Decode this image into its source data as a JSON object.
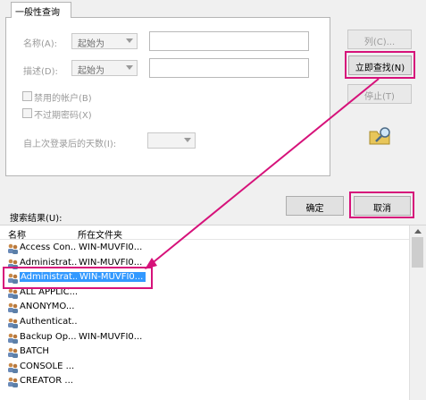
{
  "tab": {
    "label": "一般性查询"
  },
  "form": {
    "name_label": "名称(A):",
    "name_mode": "起始为",
    "desc_label": "描述(D):",
    "desc_mode": "起始为",
    "disabled_accounts_label": "禁用的帐户(B)",
    "no_expire_password_label": "不过期密码(X)",
    "days_since_logon_label": "自上次登录后的天数(I):"
  },
  "buttons": {
    "columns": "列(C)...",
    "find_now": "立即查找(N)",
    "stop": "停止(T)",
    "ok": "确定",
    "cancel": "取消"
  },
  "results": {
    "label": "搜索结果(U):",
    "columns": [
      "名称",
      "所在文件夹"
    ],
    "rows": [
      {
        "name": "Access Con...",
        "folder": "WIN-MUVFI0..."
      },
      {
        "name": "Administrat...",
        "folder": "WIN-MUVFI0..."
      },
      {
        "name": "Administrat...",
        "folder": "WIN-MUVFI0...",
        "selected": true
      },
      {
        "name": "ALL APPLIC...",
        "folder": ""
      },
      {
        "name": "ANONYMO...",
        "folder": ""
      },
      {
        "name": "Authenticat...",
        "folder": ""
      },
      {
        "name": "Backup Op...",
        "folder": "WIN-MUVFI0..."
      },
      {
        "name": "BATCH",
        "folder": ""
      },
      {
        "name": "CONSOLE ...",
        "folder": ""
      },
      {
        "name": "CREATOR ...",
        "folder": ""
      }
    ]
  },
  "colors": {
    "highlight": "#d6127a",
    "selection": "#3399ff"
  },
  "icons": [
    "search-find-icon",
    "user-group-icon"
  ]
}
